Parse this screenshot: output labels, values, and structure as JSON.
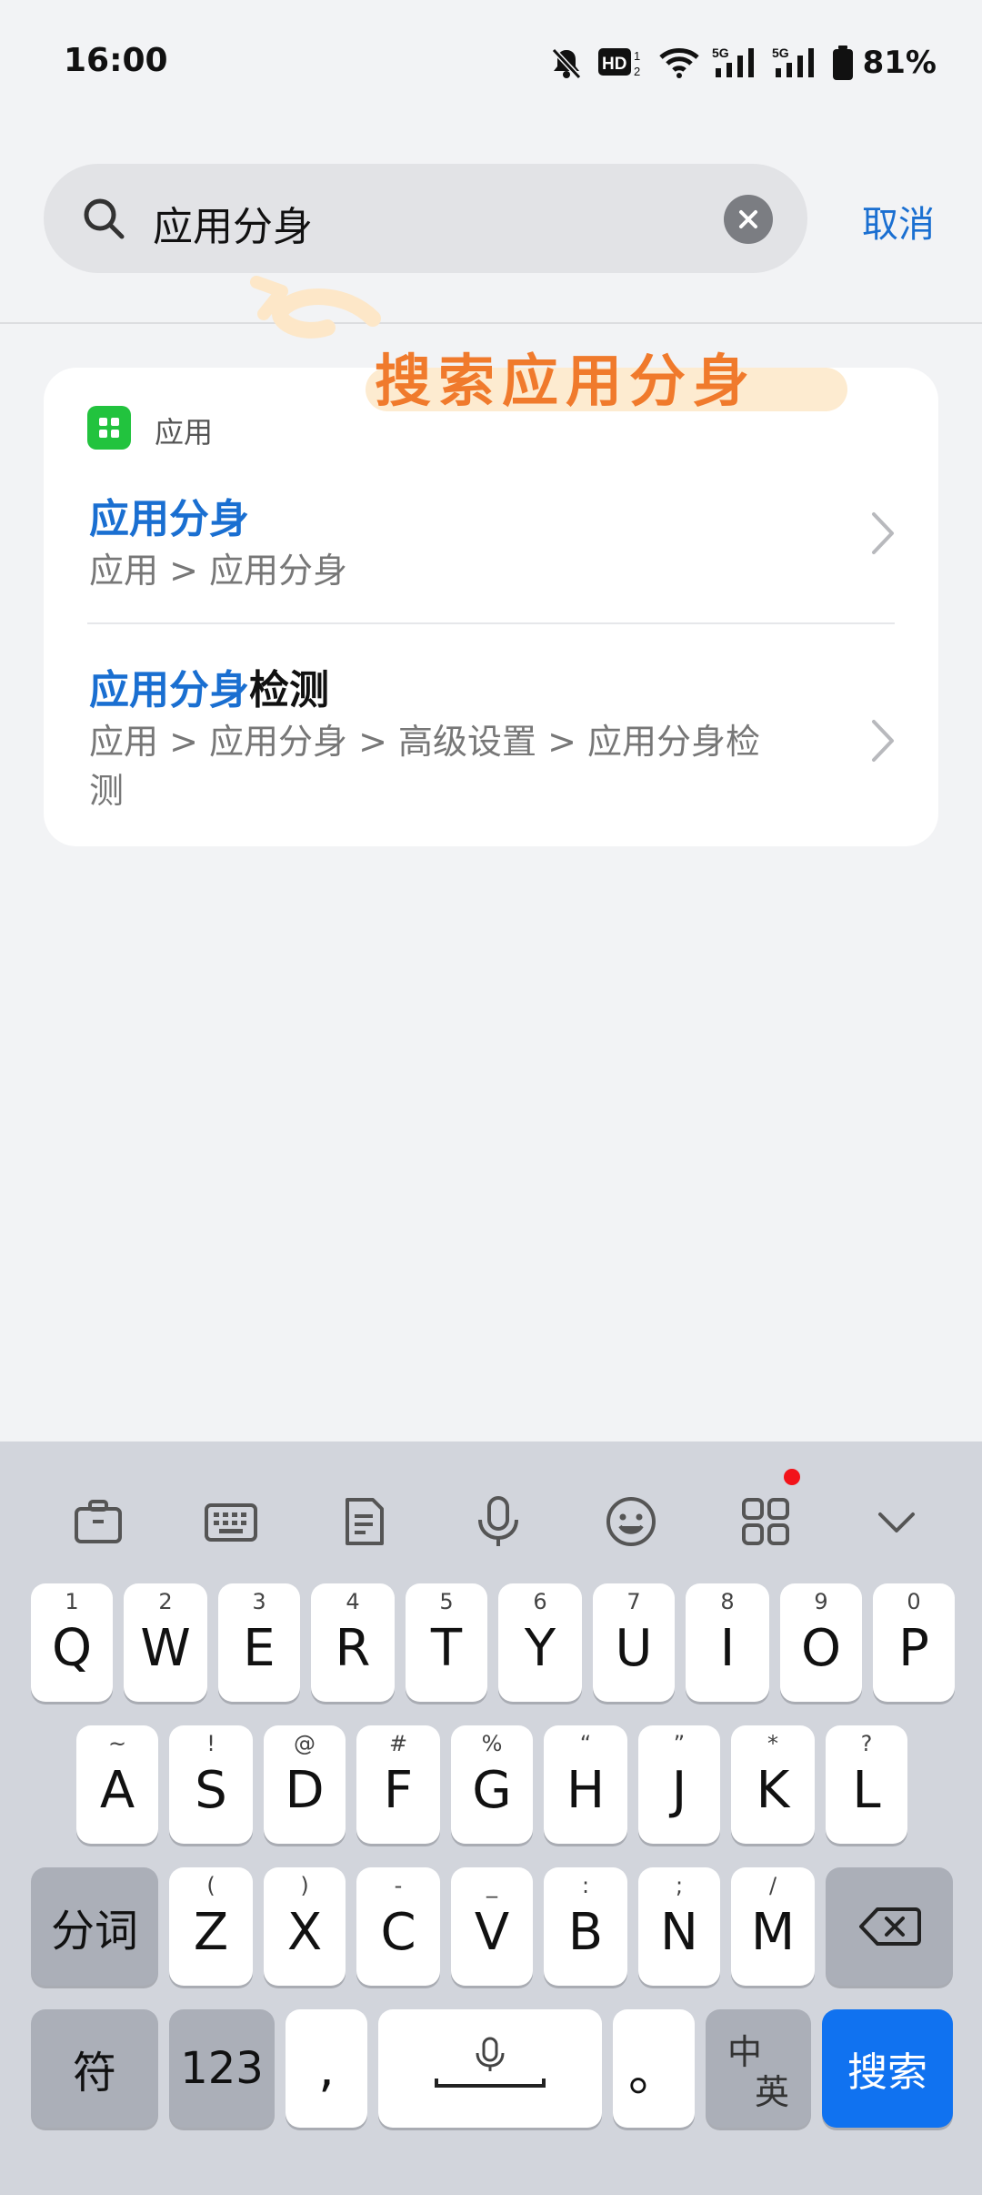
{
  "status_bar": {
    "time": "16:00",
    "battery": "81%",
    "icons": [
      "mute-bell-icon",
      "hd-voice-icon",
      "wifi-icon",
      "signal-5g-icon",
      "signal-5g-icon-2",
      "battery-icon"
    ]
  },
  "search": {
    "query": "应用分身",
    "cancel_label": "取消"
  },
  "annotation": {
    "text": "搜索应用分身"
  },
  "results": {
    "category": "应用",
    "items": [
      {
        "title_highlight": "应用分身",
        "title_rest": "",
        "path": "应用 > 应用分身"
      },
      {
        "title_highlight": "应用分身",
        "title_rest": "检测",
        "path": "应用 > 应用分身 > 高级设置 > 应用分身检测"
      }
    ]
  },
  "keyboard": {
    "toolbar_icons": [
      "toolbox-icon",
      "keyboard-icon",
      "clipboard-icon",
      "microphone-icon",
      "emoji-icon",
      "apps-grid-icon",
      "collapse-icon"
    ],
    "row1": [
      {
        "hint": "1",
        "key": "Q"
      },
      {
        "hint": "2",
        "key": "W"
      },
      {
        "hint": "3",
        "key": "E"
      },
      {
        "hint": "4",
        "key": "R"
      },
      {
        "hint": "5",
        "key": "T"
      },
      {
        "hint": "6",
        "key": "Y"
      },
      {
        "hint": "7",
        "key": "U"
      },
      {
        "hint": "8",
        "key": "I"
      },
      {
        "hint": "9",
        "key": "O"
      },
      {
        "hint": "0",
        "key": "P"
      }
    ],
    "row2": [
      {
        "hint": "~",
        "key": "A"
      },
      {
        "hint": "!",
        "key": "S"
      },
      {
        "hint": "@",
        "key": "D"
      },
      {
        "hint": "#",
        "key": "F"
      },
      {
        "hint": "%",
        "key": "G"
      },
      {
        "hint": "“",
        "key": "H"
      },
      {
        "hint": "”",
        "key": "J"
      },
      {
        "hint": "*",
        "key": "K"
      },
      {
        "hint": "?",
        "key": "L"
      }
    ],
    "row3": [
      {
        "hint": "(",
        "key": "Z"
      },
      {
        "hint": ")",
        "key": "X"
      },
      {
        "hint": "-",
        "key": "C"
      },
      {
        "hint": "_",
        "key": "V"
      },
      {
        "hint": ":",
        "key": "B"
      },
      {
        "hint": ";",
        "key": "N"
      },
      {
        "hint": "/",
        "key": "M"
      }
    ],
    "segment_label": "分词",
    "symbol_label": "符",
    "numbers_label": "123",
    "comma_label": ",",
    "period_label": "。",
    "zh_label": "中",
    "en_label": "英",
    "search_label": "搜索"
  }
}
